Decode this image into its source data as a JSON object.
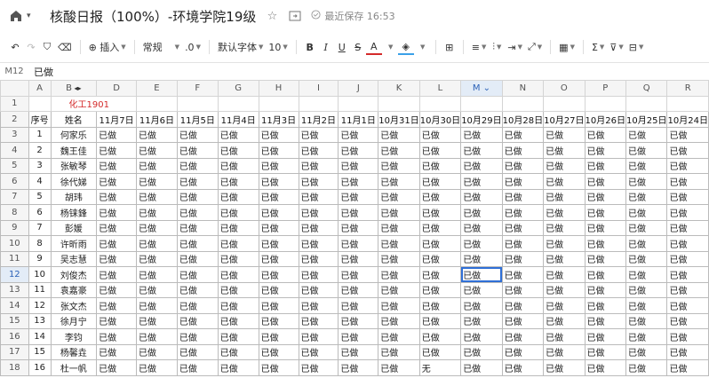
{
  "window": {
    "title": "核酸日报（100%）-环境学院19级",
    "saved_status": "最近保存 16:53"
  },
  "toolbar": {
    "insert_label": "插入",
    "format_label": "常规",
    "decimal_label": ".0",
    "font_label": "默认字体",
    "font_size": "10",
    "bold": "B",
    "italic": "I",
    "underline": "U",
    "strike": "S",
    "font_color": "A"
  },
  "formula": {
    "cell_ref": "M12",
    "value": "已做"
  },
  "columns": [
    "A",
    "B",
    "D",
    "E",
    "F",
    "G",
    "H",
    "I",
    "J",
    "K",
    "L",
    "M",
    "N",
    "O",
    "P",
    "Q",
    "R"
  ],
  "rows": [
    "1",
    "2",
    "3",
    "4",
    "5",
    "6",
    "7",
    "8",
    "9",
    "10",
    "11",
    "12",
    "13",
    "14",
    "15",
    "16",
    "17",
    "18"
  ],
  "class_label": "化工1901",
  "headers": [
    "序号",
    "姓名",
    "11月7日",
    "11月6日",
    "11月5日",
    "11月4日",
    "11月3日",
    "11月2日",
    "11月1日",
    "10月31日",
    "10月30日",
    "10月29日",
    "10月28日",
    "10月27日",
    "10月26日",
    "10月25日",
    "10月24日"
  ],
  "status_done": "已做",
  "status_none": "无",
  "students": [
    {
      "no": "1",
      "name": "何家乐"
    },
    {
      "no": "2",
      "name": "魏王佳"
    },
    {
      "no": "3",
      "name": "张敏琴"
    },
    {
      "no": "4",
      "name": "徐代娣"
    },
    {
      "no": "5",
      "name": "胡玮"
    },
    {
      "no": "6",
      "name": "杨铼鋒"
    },
    {
      "no": "7",
      "name": "彭媛"
    },
    {
      "no": "8",
      "name": "许昕雨"
    },
    {
      "no": "9",
      "name": "吴志慧"
    },
    {
      "no": "10",
      "name": "刘俊杰"
    },
    {
      "no": "11",
      "name": "袁嘉豪"
    },
    {
      "no": "12",
      "name": "张文杰"
    },
    {
      "no": "13",
      "name": "徐月宁"
    },
    {
      "no": "14",
      "name": "李钧"
    },
    {
      "no": "15",
      "name": "杨馨垚"
    },
    {
      "no": "16",
      "name": "杜一帆"
    }
  ],
  "exceptions": [
    {
      "row": 15,
      "col": 8,
      "value": "无"
    }
  ],
  "selected": {
    "row": 9,
    "col": 9
  }
}
